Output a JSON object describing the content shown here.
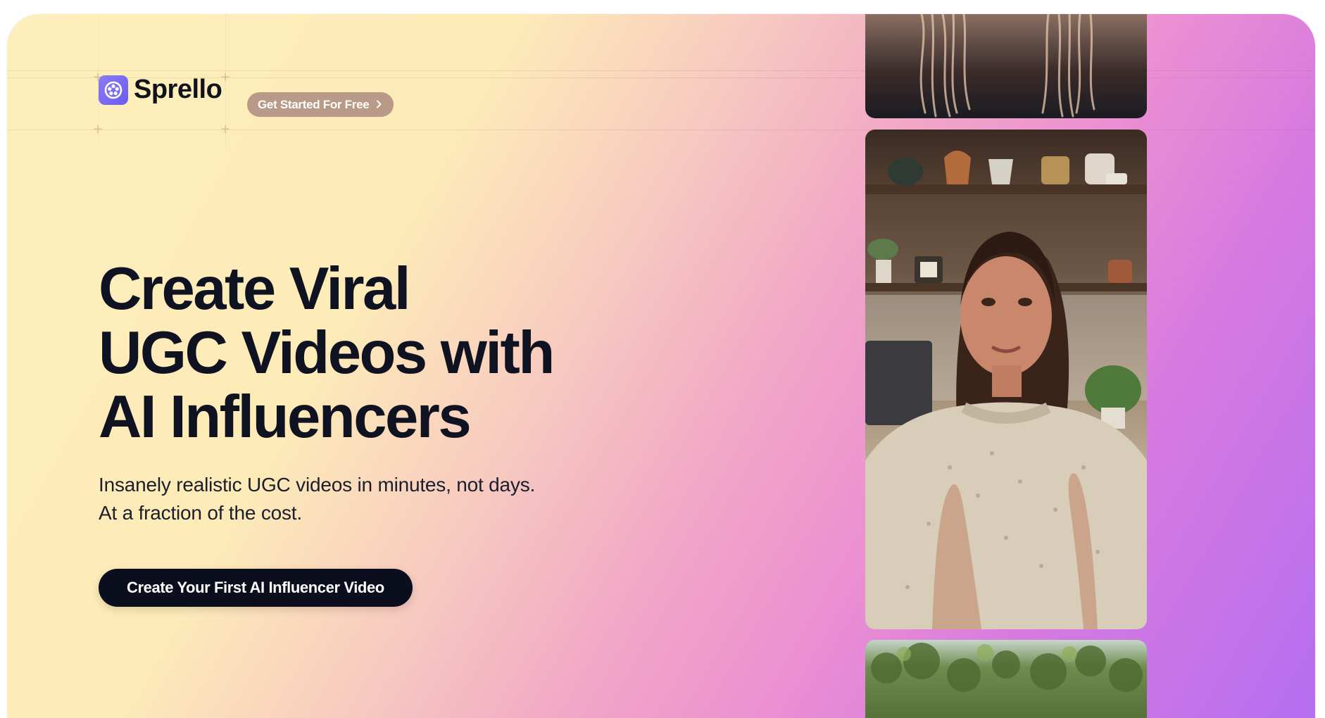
{
  "header": {
    "brand_name": "Sprello",
    "get_started_label": "Get Started For Free",
    "logo_icon": "film-reel-icon",
    "chevron_icon": "chevron-right-icon"
  },
  "hero": {
    "headline_lines": [
      "Create Viral",
      "UGC Videos with",
      "AI Influencers"
    ],
    "subtitle_lines": [
      "Insanely realistic UGC videos in minutes, not days.",
      "At a fraction of the cost."
    ],
    "cta_label": "Create Your First AI Influencer Video"
  },
  "videos": [
    {
      "name": "video-card-top",
      "subject": "hair-closeup"
    },
    {
      "name": "video-card-main",
      "subject": "woman-speaking-in-kitchen"
    },
    {
      "name": "video-card-bottom",
      "subject": "outdoor-foliage"
    }
  ],
  "colors": {
    "gradient_start": "#fdefbb",
    "gradient_mid": "#ec8fd2",
    "gradient_end": "#b66ef0",
    "text_dark": "#0f1220",
    "cta_bg": "#0b0e1c",
    "logo_bg": "#7b6cf4",
    "pill_bg": "#a17d78"
  }
}
